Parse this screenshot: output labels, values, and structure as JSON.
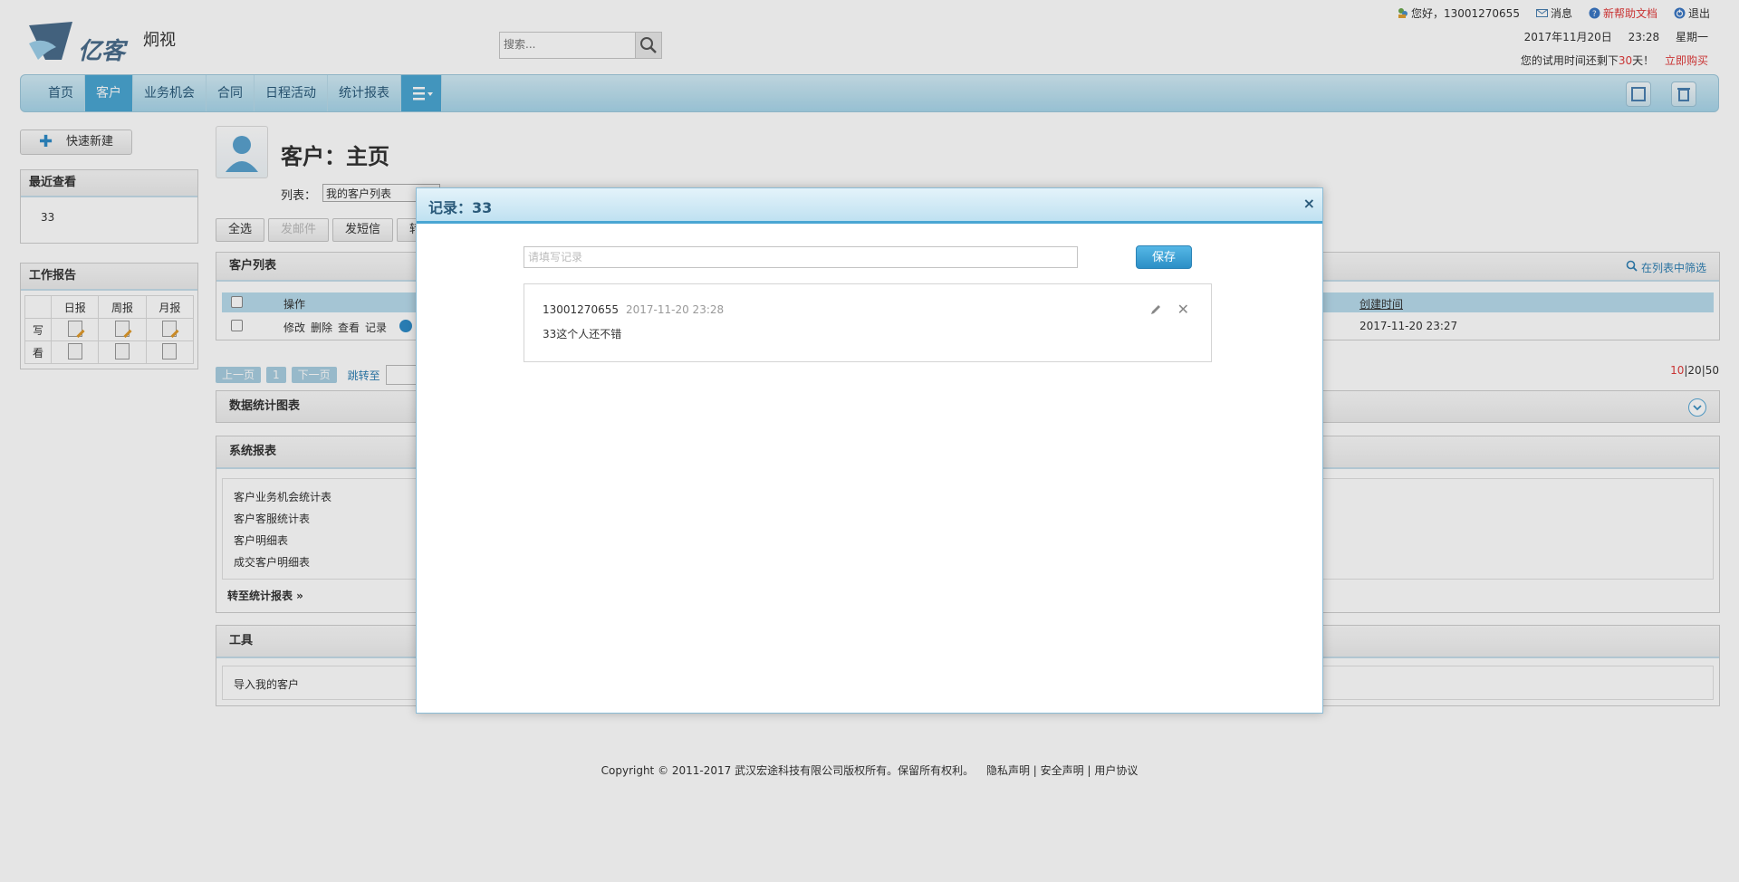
{
  "header": {
    "brand": "亿客",
    "brand_sub": "炯视",
    "search_placeholder": "搜索...",
    "greeting": "您好，13001270655",
    "messages": "消息",
    "help": "新帮助文档",
    "logout": "退出",
    "date": "2017年11月20日",
    "time": "23:28",
    "weekday": "星期一",
    "trial_prefix": "您的试用时间还剩下",
    "trial_days": "30",
    "trial_suffix": "天！",
    "buy_now": "立即购买"
  },
  "nav": {
    "items": [
      "首页",
      "客户",
      "业务机会",
      "合同",
      "日程活动",
      "统计报表"
    ],
    "active": "客户"
  },
  "sidebar": {
    "quick_new": "快速新建",
    "recent_title": "最近查看",
    "recent_item": "33",
    "report_title": "工作报告",
    "report_cols": [
      "日报",
      "周报",
      "月报"
    ],
    "report_rows": [
      "写",
      "看"
    ]
  },
  "main": {
    "title": "客户：主页",
    "list_label": "列表：",
    "list_value": "我的客户列表",
    "buttons": [
      "全选",
      "发邮件",
      "发短信",
      "转移"
    ],
    "customer_list_title": "客户列表",
    "filter_link": "在列表中筛选",
    "col_action": "操作",
    "col_created": "创建时间",
    "row_actions": [
      "修改",
      "删除",
      "查看",
      "记录"
    ],
    "row_created": "2017-11-20 23:27",
    "pager": {
      "prev": "上一页",
      "page": "1",
      "next": "下一页",
      "jump": "跳转至"
    },
    "page_size": {
      "current": "10",
      "options": "|20|50"
    },
    "stats_title": "数据统计图表",
    "system_title": "系统报表",
    "system_links": [
      "客户业务机会统计表",
      "客户客服统计表",
      "客户明细表",
      "成交客户明细表"
    ],
    "goto_reports": "转至统计报表 »",
    "tools_title": "工具",
    "tools_link": "导入我的客户"
  },
  "dialog": {
    "title": "记录：33",
    "close": "×",
    "input_placeholder": "请填写记录",
    "save": "保存",
    "record": {
      "author": "13001270655",
      "time": "2017-11-20 23:28",
      "text": "33这个人还不错",
      "delete": "✕"
    }
  },
  "footer": {
    "copyright": "Copyright © 2011-2017 武汉宏途科技有限公司版权所有。保留所有权利。",
    "links": [
      "隐私声明",
      "安全声明",
      "用户协议"
    ]
  },
  "colors": {
    "accent": "#4aa6d3",
    "nav_bg": "#bfe1f1",
    "warning": "#e03a3a"
  }
}
